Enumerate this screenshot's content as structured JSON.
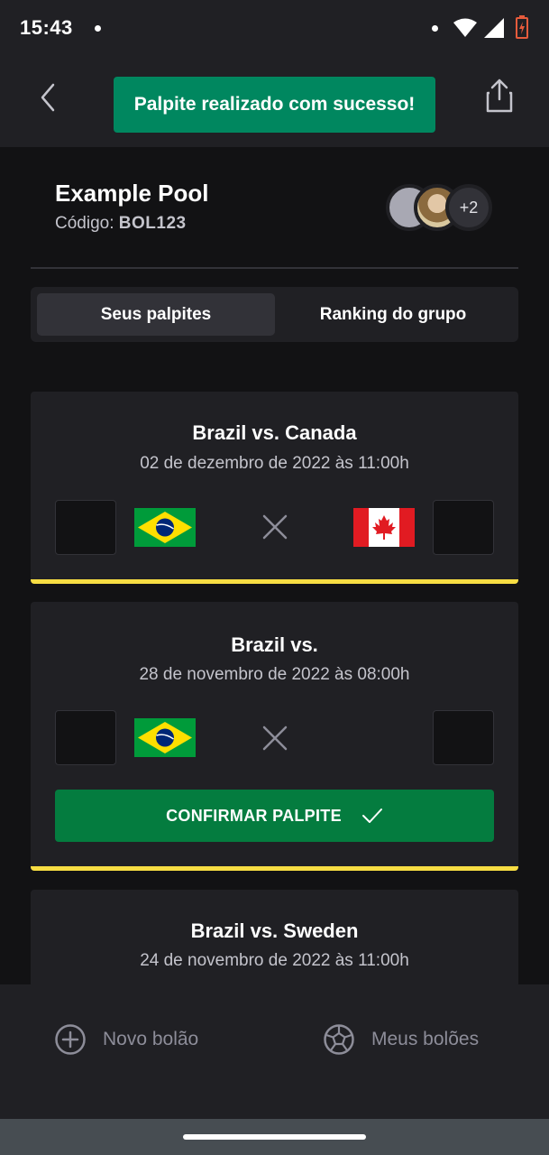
{
  "status_bar": {
    "time": "15:43"
  },
  "header": {
    "toast": "Palpite realizado com sucesso!"
  },
  "pool": {
    "title": "Example Pool",
    "code_label": "Código:",
    "code": "BOL123",
    "extra_participants": "+2"
  },
  "tabs": [
    {
      "label": "Seus palpites",
      "active": true
    },
    {
      "label": "Ranking do grupo",
      "active": false
    }
  ],
  "matches": [
    {
      "title": "Brazil vs. Canada",
      "date": "02 de dezembro de 2022 às 11:00h",
      "home_flag": "brazil-flag",
      "away_flag": "canada-flag"
    },
    {
      "title": "Brazil vs.",
      "date": "28 de novembro de 2022 às 08:00h",
      "home_flag": "brazil-flag",
      "confirm_label": "CONFIRMAR PALPITE"
    },
    {
      "title": "Brazil vs. Sweden",
      "date": "24 de novembro de 2022 às 11:00h"
    }
  ],
  "bottom_nav": {
    "new_pool": "Novo bolão",
    "my_pools": "Meus bolões"
  },
  "colors": {
    "background": "#121214",
    "surface": "#202024",
    "success_green": "#00875f",
    "accent_yellow": "#f7dd43"
  }
}
